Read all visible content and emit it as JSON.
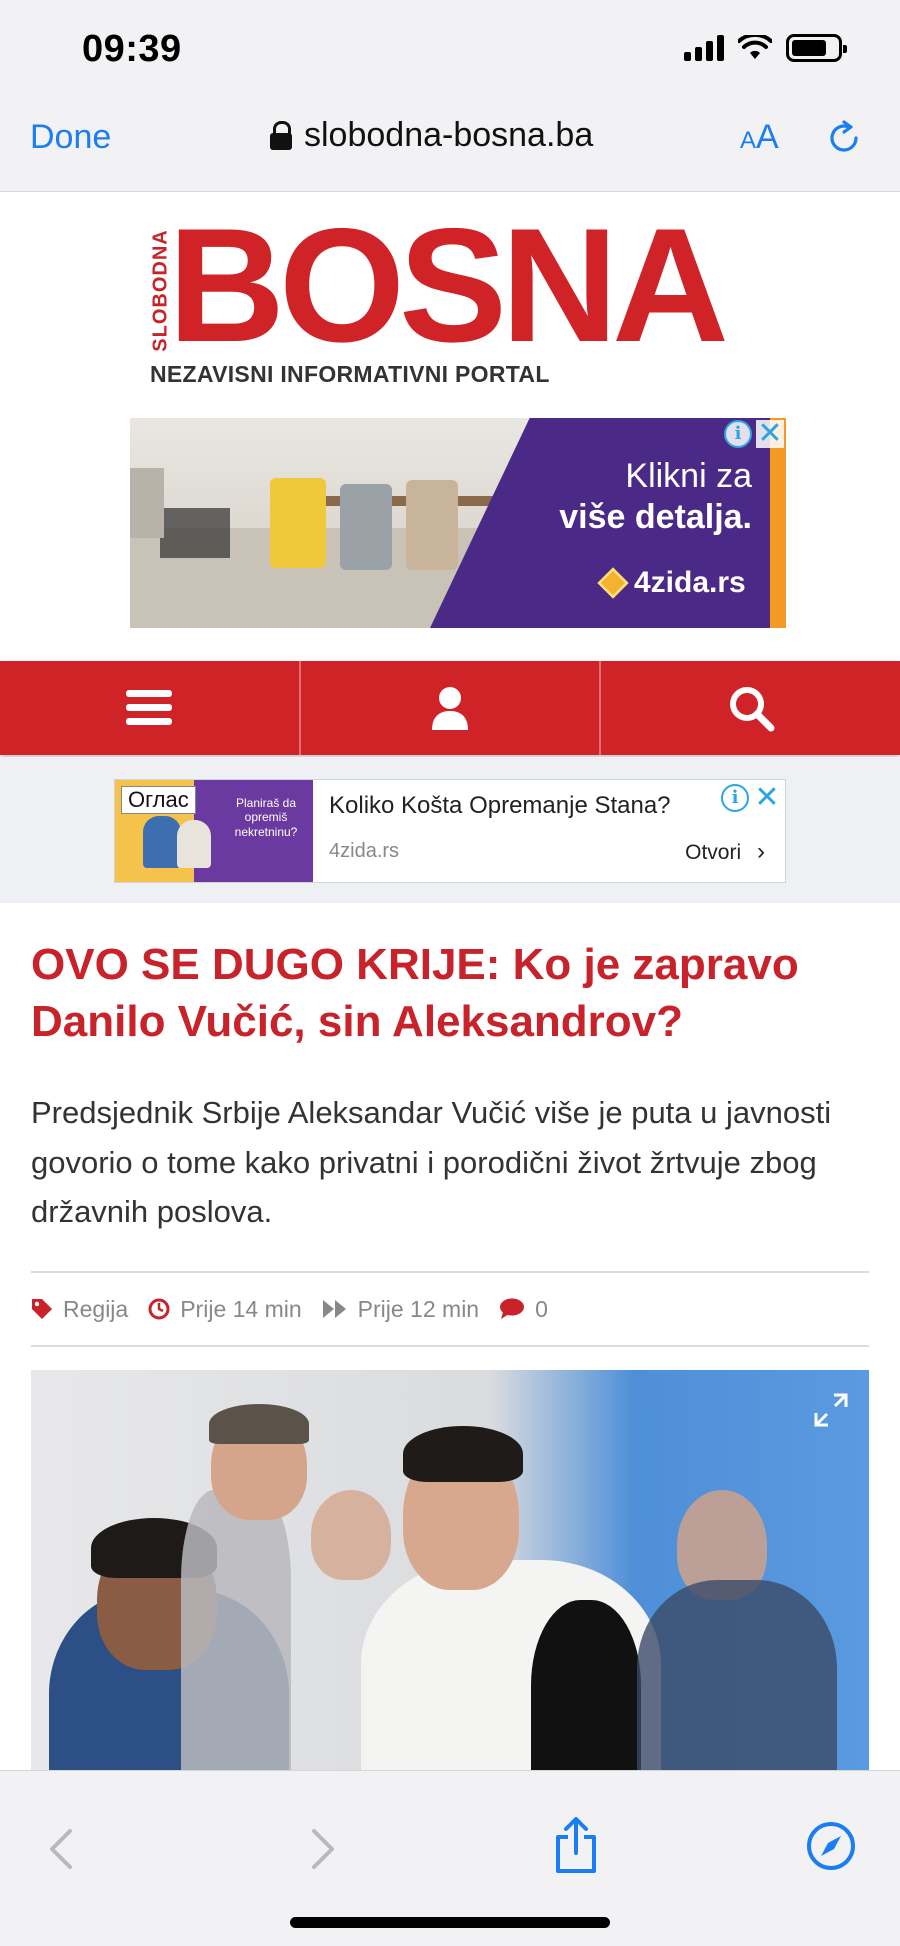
{
  "status": {
    "time": "09:39"
  },
  "browser": {
    "done_label": "Done",
    "url": "slobodna-bosna.ba",
    "aa_small": "A",
    "aa_big": "A"
  },
  "logo": {
    "vertical": "SLOBODNA",
    "main": "BOSNA",
    "tagline": "NEZAVISNI INFORMATIVNI PORTAL"
  },
  "ad_top": {
    "line1": "Klikni za",
    "line2": "više detalja.",
    "brand": "4zida.rs",
    "info_icon": "i",
    "close_icon": "✕"
  },
  "ad_native": {
    "badge": "Оглас",
    "thumb_text": "Planiraš da opremiš nekretninu?",
    "title": "Koliko Košta Opremanje Stana?",
    "domain": "4zida.rs",
    "cta": "Otvori"
  },
  "article": {
    "headline": "OVO SE DUGO KRIJE: Ko je zapravo Danilo Vučić, sin Aleksandrov?",
    "lead": "Predsjednik Srbije Aleksandar Vučić više je puta u javnosti govorio o tome kako privatni i porodični život žrtvuje zbog državnih poslova.",
    "category": "Regija",
    "published": "Prije 14 min",
    "updated": "Prije 12 min",
    "comments": "0"
  },
  "colors": {
    "brand_red": "#cf2327",
    "ios_blue": "#1a7ef2",
    "ad_purple": "#4a2a86",
    "ad_orange": "#f39a25"
  }
}
